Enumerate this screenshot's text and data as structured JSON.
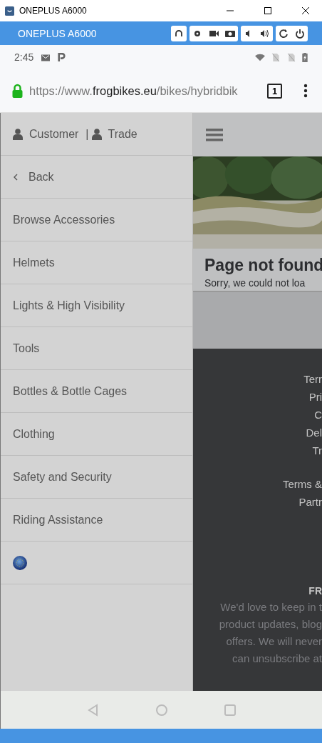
{
  "window": {
    "title": "ONEPLUS A6000"
  },
  "device_bar": {
    "title": "ONEPLUS A6000"
  },
  "status_bar": {
    "time": "2:45"
  },
  "browser": {
    "url_scheme": "https://www.",
    "url_domain": "frogbikes.eu",
    "url_path": "/bikes/hybridbik",
    "tab_count": "1"
  },
  "menu": {
    "account": [
      {
        "label": "Customer"
      },
      {
        "label": "Trade"
      }
    ],
    "separator": "|",
    "items": [
      {
        "kind": "back",
        "label": "Back"
      },
      {
        "kind": "link",
        "label": "Browse Accessories"
      },
      {
        "kind": "link",
        "label": "Helmets"
      },
      {
        "kind": "link",
        "label": "Lights & High Visibility"
      },
      {
        "kind": "link",
        "label": "Tools"
      },
      {
        "kind": "link",
        "label": "Bottles & Bottle Cages"
      },
      {
        "kind": "link",
        "label": "Clothing"
      },
      {
        "kind": "link",
        "label": "Safety and Security"
      },
      {
        "kind": "link",
        "label": "Riding Assistance"
      },
      {
        "kind": "flag"
      }
    ]
  },
  "page": {
    "hero": {
      "kind": "picture"
    },
    "heading": "Page not found",
    "message": "Sorry, we could not loa",
    "footer_links": [
      "Terr",
      "Pri",
      "C",
      "Del",
      "Tr"
    ],
    "footer_links_2": [
      "Terms &",
      "Partr"
    ],
    "newsletter_title": "FR",
    "newsletter_lines": [
      "We'd love to keep in t",
      "product updates, blog",
      "offers. We will never",
      "can unsubscribe at"
    ]
  }
}
